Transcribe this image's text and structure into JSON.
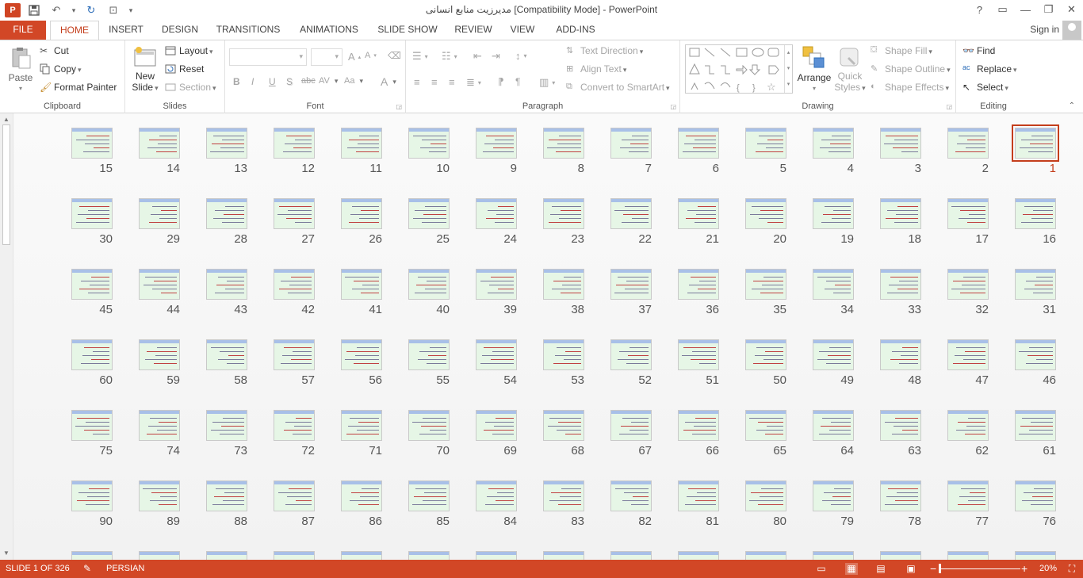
{
  "window": {
    "title": "مدیرزیت منابع انسانی [Compatibility Mode] - PowerPoint",
    "help": "?",
    "controls": [
      "ribbon-display",
      "minimize",
      "restore",
      "close"
    ]
  },
  "tabs": [
    "FILE",
    "HOME",
    "INSERT",
    "DESIGN",
    "TRANSITIONS",
    "ANIMATIONS",
    "SLIDE SHOW",
    "REVIEW",
    "VIEW",
    "ADD-INS"
  ],
  "signin": "Sign in",
  "ribbon": {
    "clipboard": {
      "label": "Clipboard",
      "paste": "Paste",
      "cut": "Cut",
      "copy": "Copy",
      "format_painter": "Format Painter"
    },
    "slides": {
      "label": "Slides",
      "new_slide": "New",
      "new_slide2": "Slide",
      "layout": "Layout",
      "reset": "Reset",
      "section": "Section"
    },
    "font": {
      "label": "Font",
      "bold": "B",
      "italic": "I",
      "underline": "U",
      "shadow": "S",
      "strike": "abc",
      "spacing": "AV",
      "case": "Aa",
      "color": "A"
    },
    "paragraph": {
      "label": "Paragraph",
      "text_direction": "Text Direction",
      "align_text": "Align Text",
      "convert_smartart": "Convert to SmartArt"
    },
    "drawing": {
      "label": "Drawing",
      "arrange": "Arrange",
      "quick_styles": "Quick",
      "quick_styles2": "Styles",
      "shape_fill": "Shape Fill",
      "shape_outline": "Shape Outline",
      "shape_effects": "Shape Effects"
    },
    "editing": {
      "label": "Editing",
      "find": "Find",
      "replace": "Replace",
      "select": "Select"
    }
  },
  "slides": {
    "rows": [
      [
        15,
        14,
        13,
        12,
        11,
        10,
        9,
        8,
        7,
        6,
        5,
        4,
        3,
        2,
        1
      ],
      [
        30,
        29,
        28,
        27,
        26,
        25,
        24,
        23,
        22,
        21,
        20,
        19,
        18,
        17,
        16
      ],
      [
        45,
        44,
        43,
        42,
        41,
        40,
        39,
        38,
        37,
        36,
        35,
        34,
        33,
        32,
        31
      ],
      [
        60,
        59,
        58,
        57,
        56,
        55,
        54,
        53,
        52,
        51,
        50,
        49,
        48,
        47,
        46
      ],
      [
        75,
        74,
        73,
        72,
        71,
        70,
        69,
        68,
        67,
        66,
        65,
        64,
        63,
        62,
        61
      ],
      [
        90,
        89,
        88,
        87,
        86,
        85,
        84,
        83,
        82,
        81,
        80,
        79,
        78,
        77,
        76
      ]
    ],
    "selected": 1
  },
  "status": {
    "slide": "SLIDE 1 OF 326",
    "language": "PERSIAN",
    "zoom": "20%",
    "colors": {
      "accent": "#d24726",
      "selected": "#c43e1c"
    }
  }
}
